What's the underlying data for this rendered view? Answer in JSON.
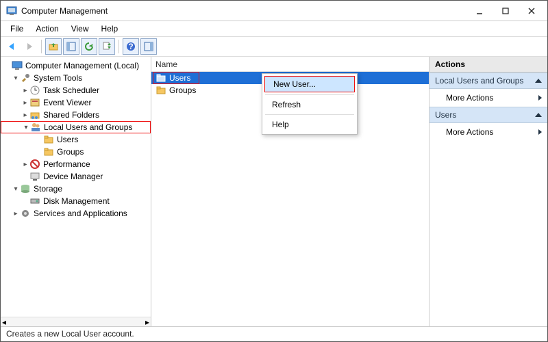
{
  "window": {
    "title": "Computer Management"
  },
  "menubar": {
    "items": [
      "File",
      "Action",
      "View",
      "Help"
    ]
  },
  "toolbar": {
    "icons": [
      "back",
      "forward",
      "up",
      "show-hide",
      "refresh",
      "export",
      "properties",
      "help",
      "panel"
    ]
  },
  "tree": {
    "root": "Computer Management (Local)",
    "system_tools": {
      "label": "System Tools",
      "task_scheduler": "Task Scheduler",
      "event_viewer": "Event Viewer",
      "shared_folders": "Shared Folders",
      "local_users_groups": {
        "label": "Local Users and Groups",
        "users": "Users",
        "groups": "Groups"
      },
      "performance": "Performance",
      "device_manager": "Device Manager"
    },
    "storage": {
      "label": "Storage",
      "disk_mgmt": "Disk Management"
    },
    "services_apps": "Services and Applications"
  },
  "list": {
    "header": "Name",
    "users": "Users",
    "groups": "Groups"
  },
  "context_menu": {
    "new_user": "New User...",
    "refresh": "Refresh",
    "help": "Help"
  },
  "actions": {
    "title": "Actions",
    "group1": "Local Users and Groups",
    "group2": "Users",
    "more": "More Actions"
  },
  "status": "Creates a new Local User account."
}
